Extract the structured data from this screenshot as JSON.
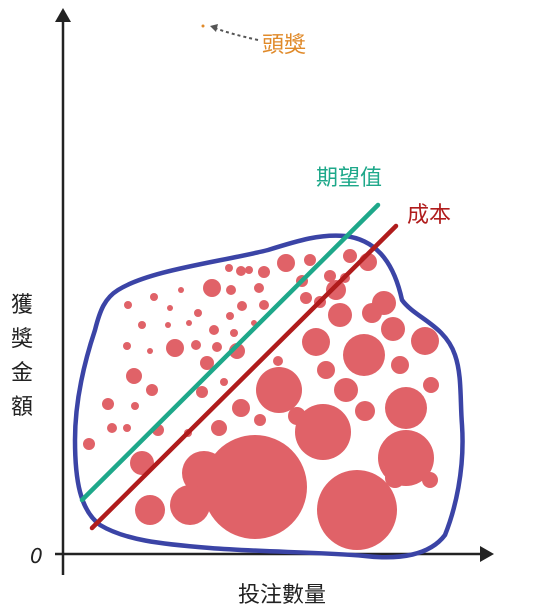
{
  "labels": {
    "jackpot": "頭獎",
    "expected_value": "期望值",
    "cost": "成本",
    "y_axis": [
      "獲",
      "獎",
      "金",
      "額"
    ],
    "x_axis": "投注數量",
    "origin": "0"
  },
  "colors": {
    "axis": "#222222",
    "blob_outline": "#3b44a6",
    "expected_value_line": "#1ea88a",
    "cost_line": "#b01c1c",
    "dots": "#e06268",
    "jackpot_label": "#e08a2a",
    "arrow": "#555555"
  }
}
